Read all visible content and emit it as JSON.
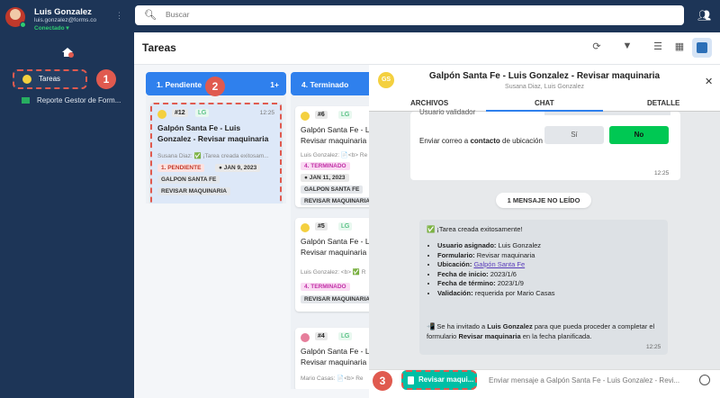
{
  "user": {
    "name": "Luis Gonzalez",
    "email": "luis.gonzalez@forms.co",
    "status": "Conectado"
  },
  "sidebar": {
    "items": [
      {
        "label": "Tareas"
      },
      {
        "label": "Reporte Gestor de Form..."
      }
    ]
  },
  "search": {
    "placeholder": "Buscar"
  },
  "page": {
    "title": "Tareas"
  },
  "callouts": [
    "1",
    "2",
    "3"
  ],
  "columns": [
    {
      "title": "1. Pendiente",
      "count": "1+"
    },
    {
      "title": "4. Terminado"
    }
  ],
  "cards_pending": [
    {
      "id": "#12",
      "assignee": "LG",
      "time": "12:25",
      "title": "Galpón Santa Fe - Luis Gonzalez - Revisar maquinaria",
      "sub": "Susana Diaz: ✅ ¡Tarea creada exitosam...",
      "status": "1. PENDIENTE",
      "date": "JAN 9, 2023",
      "tags": [
        "GALPON SANTA FE",
        "REVISAR MAQUINARIA"
      ]
    }
  ],
  "cards_done": [
    {
      "id": "#6",
      "assignee": "LG",
      "title": "Galpón Santa Fe - Luis Gonzalez - Revisar maquinaria",
      "sub": "Luis Gonzalez: 📄<b> Re",
      "status": "4. TERMINADO",
      "date": "JAN 11, 2023",
      "tags": [
        "GALPON SANTA FE",
        "REVISAR MAQUINARIA"
      ]
    },
    {
      "id": "#5",
      "assignee": "LG",
      "title": "Galpón Santa Fe - Luis Gonzalez - Revisar maquinaria",
      "sub": "Luis Gonzalez: <b> ✅ R",
      "status": "4. TERMINADO",
      "tags": [
        "REVISAR MAQUINARIA"
      ]
    },
    {
      "id": "#4",
      "assignee": "LG",
      "title": "Galpón Santa Fe - Luis Gonzalez - Revisar maquinaria",
      "sub": "Mario Casas: 📄<b> Re"
    }
  ],
  "chat": {
    "avatar": "GS",
    "title": "Galpón Santa Fe - Luis Gonzalez - Revisar maquinaria",
    "participants": "Susana Diaz, Luis Gonzalez",
    "tabs": [
      "ARCHIVOS",
      "CHAT",
      "DETALLE"
    ],
    "form_line1": "Usuario validador",
    "form_q_pre": "Enviar correo a ",
    "form_q_bold": "contacto",
    "form_q_post": " de ubicación al terminar tarea",
    "yes": "Sí",
    "no": "No",
    "time1": "12:25",
    "unread": "1 MENSAJE NO LEÍDO",
    "sys_header": "✅ ¡Tarea creada exitosamente!",
    "sys_items": [
      {
        "k": "Usuario asignado:",
        "v": "Luis Gonzalez"
      },
      {
        "k": "Formulario:",
        "v": "Revisar maquinaria"
      },
      {
        "k": "Ubicación:",
        "v": "Galpón Santa Fe"
      },
      {
        "k": "Fecha de inicio:",
        "v": "2023/1/6"
      },
      {
        "k": "Fecha de término:",
        "v": "2023/1/9"
      },
      {
        "k": "Validación:",
        "v": "requerida por Mario Casas"
      }
    ],
    "invite_pre": "📲 Se ha invitado a ",
    "invite_user": "Luis Gonzalez",
    "invite_mid": " para que pueda proceder a completar el formulario ",
    "invite_form": "Revisar maquinaria",
    "invite_post": " en la fecha planificada.",
    "time2": "12:25",
    "produce_btn": "Revisar maqui...",
    "input_placeholder": "Enviar mensaje a Galpón Santa Fe - Luis Gonzalez - Revi..."
  },
  "colors": {
    "navy": "#1d3557",
    "blue": "#2f80ed",
    "green": "#00c853",
    "callout": "#e05a4f"
  }
}
